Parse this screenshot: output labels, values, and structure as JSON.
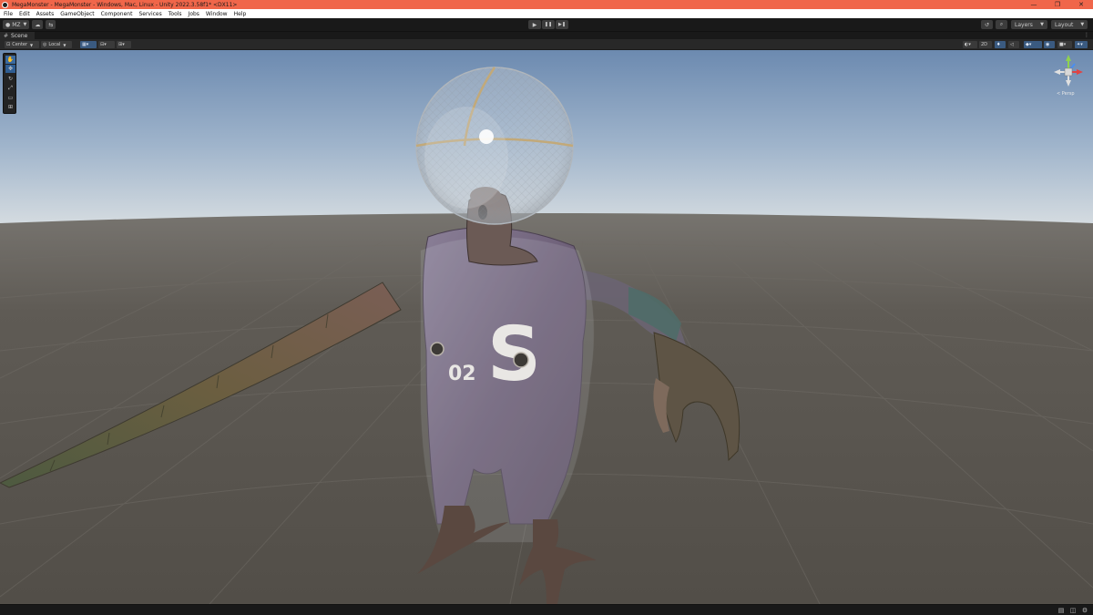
{
  "window": {
    "title": "MegaMonster - MegaMonster - Windows, Mac, Linux - Unity 2022.3.58f1* <DX11>",
    "minimize": "—",
    "maximize": "❐",
    "close": "✕"
  },
  "menu": [
    "File",
    "Edit",
    "Assets",
    "GameObject",
    "Component",
    "Services",
    "Tools",
    "Jobs",
    "Window",
    "Help"
  ],
  "toolbar": {
    "account_label": "MZ",
    "play_icon": "▶",
    "pause_icon": "❚❚",
    "step_icon": "▶❚",
    "history_icon": "↺",
    "search_icon": "⌕",
    "layers_label": "Layers",
    "layout_label": "Layout"
  },
  "scene_tab": {
    "label": "Scene",
    "more": "⋮"
  },
  "scene_toolbar": {
    "pivot_mode": "Center",
    "pivot_rotation": "Local",
    "mode_2d": "2D"
  },
  "tools": [
    {
      "name": "hand-tool",
      "glyph": "✋"
    },
    {
      "name": "move-tool",
      "glyph": "✥"
    },
    {
      "name": "rotate-tool",
      "glyph": "↻"
    },
    {
      "name": "scale-tool",
      "glyph": "⤢"
    },
    {
      "name": "rect-tool",
      "glyph": "▭"
    },
    {
      "name": "transform-tool",
      "glyph": "⊞"
    }
  ],
  "gizmo": {
    "projection_label": "< Persp"
  },
  "scene": {
    "chest_letter": "S",
    "chest_number": "02"
  },
  "colors": {
    "title_bar": "#f0664a",
    "active_tool": "#3a6aa0",
    "sky_top": "#6f8db3",
    "horizon": "#cbd5dc",
    "ground": "#57534d"
  }
}
